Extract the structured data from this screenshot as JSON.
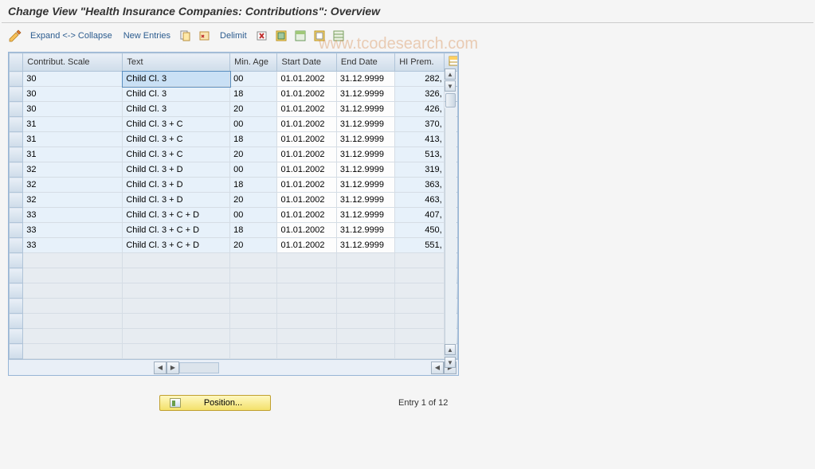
{
  "title": "Change View \"Health Insurance Companies: Contributions\": Overview",
  "toolbar": {
    "expand_collapse": "Expand <-> Collapse",
    "new_entries": "New Entries",
    "delimit": "Delimit"
  },
  "watermark": "www.tcodesearch.com",
  "columns": {
    "scale": "Contribut. Scale",
    "text": "Text",
    "age": "Min. Age",
    "start": "Start Date",
    "end": "End Date",
    "prem": "HI Prem."
  },
  "rows": [
    {
      "scale": "30",
      "text": "Child Cl. 3",
      "age": "00",
      "start": "01.01.2002",
      "end": "31.12.9999",
      "prem": "282,"
    },
    {
      "scale": "30",
      "text": "Child Cl. 3",
      "age": "18",
      "start": "01.01.2002",
      "end": "31.12.9999",
      "prem": "326,"
    },
    {
      "scale": "30",
      "text": "Child Cl. 3",
      "age": "20",
      "start": "01.01.2002",
      "end": "31.12.9999",
      "prem": "426,"
    },
    {
      "scale": "31",
      "text": "Child Cl. 3 + C",
      "age": "00",
      "start": "01.01.2002",
      "end": "31.12.9999",
      "prem": "370,"
    },
    {
      "scale": "31",
      "text": "Child Cl. 3 + C",
      "age": "18",
      "start": "01.01.2002",
      "end": "31.12.9999",
      "prem": "413,"
    },
    {
      "scale": "31",
      "text": "Child Cl. 3 + C",
      "age": "20",
      "start": "01.01.2002",
      "end": "31.12.9999",
      "prem": "513,"
    },
    {
      "scale": "32",
      "text": "Child Cl. 3 + D",
      "age": "00",
      "start": "01.01.2002",
      "end": "31.12.9999",
      "prem": "319,"
    },
    {
      "scale": "32",
      "text": "Child Cl. 3 + D",
      "age": "18",
      "start": "01.01.2002",
      "end": "31.12.9999",
      "prem": "363,"
    },
    {
      "scale": "32",
      "text": "Child Cl. 3 + D",
      "age": "20",
      "start": "01.01.2002",
      "end": "31.12.9999",
      "prem": "463,"
    },
    {
      "scale": "33",
      "text": "Child Cl. 3 + C + D",
      "age": "00",
      "start": "01.01.2002",
      "end": "31.12.9999",
      "prem": "407,"
    },
    {
      "scale": "33",
      "text": "Child Cl. 3 + C + D",
      "age": "18",
      "start": "01.01.2002",
      "end": "31.12.9999",
      "prem": "450,"
    },
    {
      "scale": "33",
      "text": "Child Cl. 3 + C + D",
      "age": "20",
      "start": "01.01.2002",
      "end": "31.12.9999",
      "prem": "551,"
    }
  ],
  "empty_row_count": 7,
  "footer": {
    "position_label": "Position...",
    "entry_text": "Entry 1 of 12"
  }
}
